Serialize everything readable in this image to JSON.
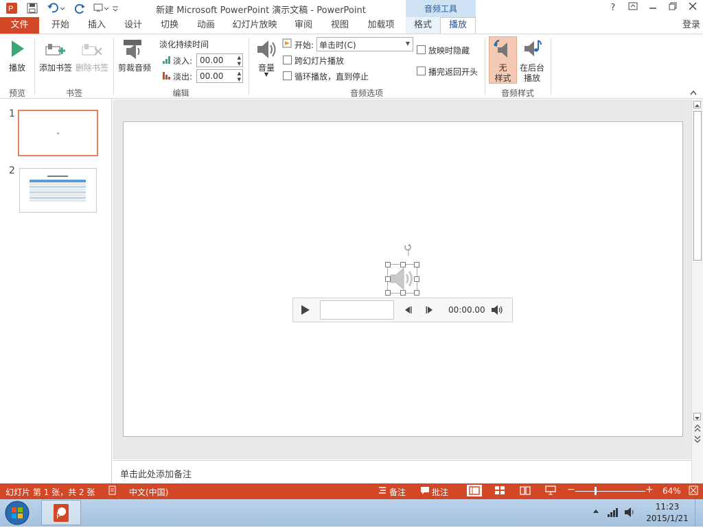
{
  "window": {
    "title": "新建 Microsoft PowerPoint 演示文稿 - PowerPoint",
    "context_tool_label": "音频工具",
    "help": "?",
    "login": "登录"
  },
  "tabs": {
    "file": "文件",
    "items": [
      "开始",
      "插入",
      "设计",
      "切换",
      "动画",
      "幻灯片放映",
      "审阅",
      "视图",
      "加载项",
      "格式",
      "播放"
    ],
    "active": "播放"
  },
  "ribbon": {
    "preview": {
      "play_label": "播放",
      "group": "预览"
    },
    "bookmarks": {
      "add_label": "添加书签",
      "remove_label": "删除书签",
      "group": "书签"
    },
    "edit": {
      "trim_label": "剪裁音频",
      "fade_title": "淡化持续时间",
      "fade_in_label": "淡入:",
      "fade_in_value": "00.00",
      "fade_out_label": "淡出:",
      "fade_out_value": "00.00",
      "group": "编辑"
    },
    "audio_options": {
      "volume_label": "音量",
      "start_label": "开始:",
      "start_value": "单击时(C)",
      "cross_slides": "跨幻灯片播放",
      "loop": "循环播放，直到停止",
      "hide_during_show": "放映时隐藏",
      "rewind": "播完返回开头",
      "group": "音频选项"
    },
    "audio_styles": {
      "no_style_line1": "无",
      "no_style_line2": "样式",
      "bg_line1": "在后台",
      "bg_line2": "播放",
      "group": "音频样式"
    }
  },
  "slides": [
    {
      "number": "1",
      "selected": true
    },
    {
      "number": "2",
      "selected": false
    }
  ],
  "player": {
    "time": "00:00.00"
  },
  "notes": {
    "placeholder": "单击此处添加备注"
  },
  "status": {
    "slide_info": "幻灯片 第 1 张，共 2 张",
    "language": "中文(中国)",
    "notes": "备注",
    "comments": "批注",
    "zoom": "64%"
  },
  "taskbar": {
    "time": "11:23",
    "date": "2015/1/21"
  },
  "colors": {
    "accent": "#d24726",
    "ribbon_blue": "#2b579a",
    "context_band": "#cfe3f5",
    "selected_style": "#f5c9b3"
  }
}
